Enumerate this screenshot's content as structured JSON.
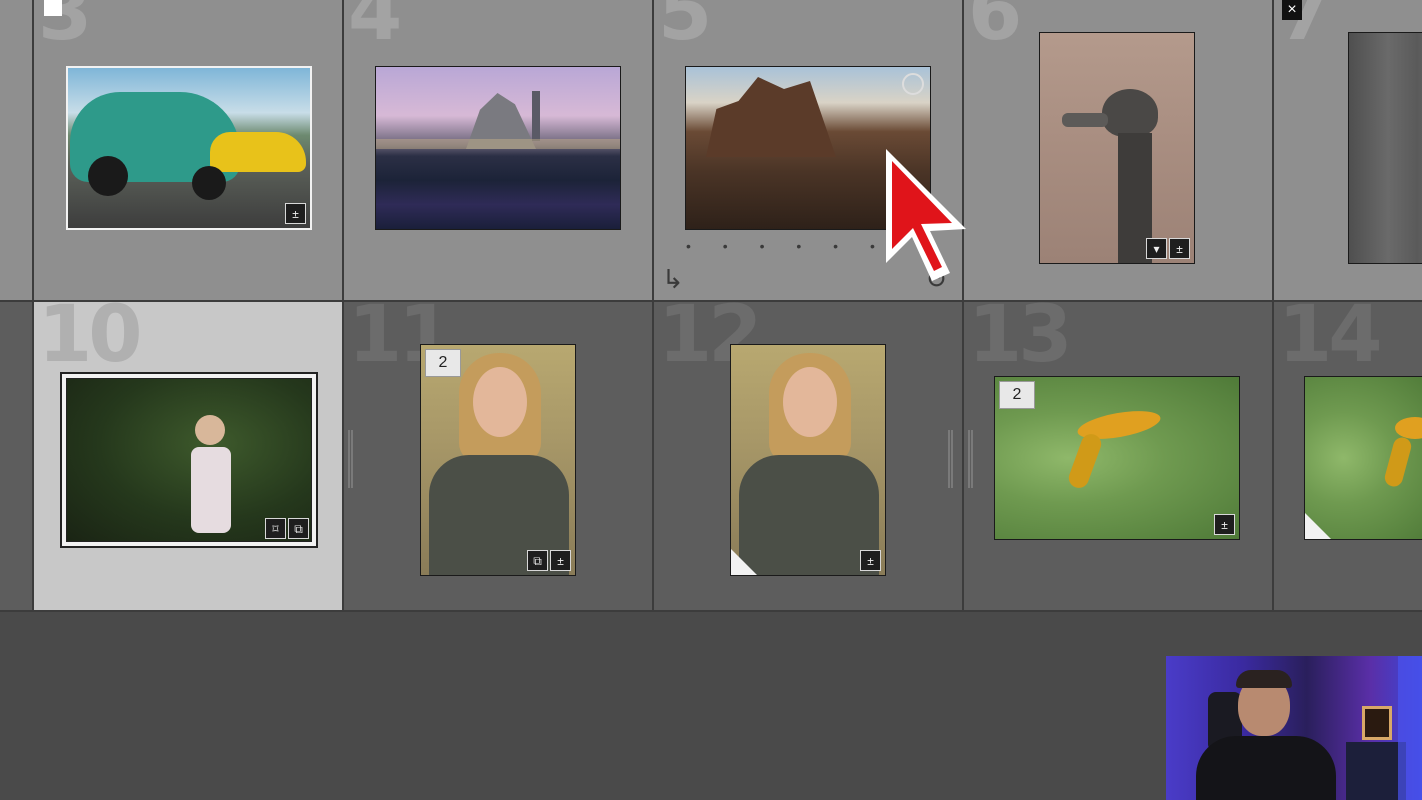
{
  "grid": {
    "row1": [
      {
        "index": "3",
        "icons": [
          "develop-adjusted-icon"
        ]
      },
      {
        "index": "4"
      },
      {
        "index": "5",
        "pagination_dots": "• • • • • •"
      },
      {
        "index": "6",
        "icons": [
          "comment-icon",
          "develop-adjusted-icon"
        ]
      },
      {
        "index": "7"
      }
    ],
    "row2": [
      {
        "index": "10",
        "icons": [
          "keyword-tag-icon",
          "virtual-copy-icon"
        ]
      },
      {
        "index": "11",
        "stack_count": "2",
        "icons": [
          "virtual-copy-icon",
          "develop-adjusted-icon"
        ]
      },
      {
        "index": "12",
        "icons": [
          "develop-adjusted-icon"
        ]
      },
      {
        "index": "13",
        "stack_count": "2",
        "icons": [
          "develop-adjusted-icon"
        ]
      },
      {
        "index": "14"
      }
    ]
  },
  "symbols": {
    "close": "×",
    "rotate_left": "↳",
    "rotate_right": "↺",
    "develop_adjusted": "±",
    "virtual_copy": "⧉",
    "comment": "▾",
    "keyword_tag": "⌑"
  },
  "colors": {
    "row1_bg": "#8f8f8f",
    "row2_bg": "#5d5d5d",
    "selected_bg": "#c8c8c8",
    "cursor": "#e0141a"
  }
}
